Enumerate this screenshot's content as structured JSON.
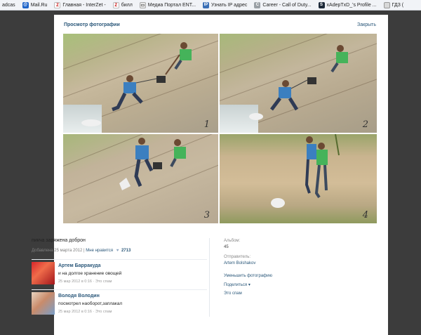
{
  "bookmarks": [
    {
      "label": "adcas",
      "icon": "none"
    },
    {
      "label": "Mail.Ru",
      "icon": "mail-icon"
    },
    {
      "label": "Главная - InterZet -",
      "icon": "interzet-icon"
    },
    {
      "label": "билл",
      "icon": "interzet-icon"
    },
    {
      "label": "Медиа Портал ENT...",
      "icon": "media-icon"
    },
    {
      "label": "Узнать IP адрес",
      "icon": "ip-icon"
    },
    {
      "label": "Career - Call of Duty...",
      "icon": "career-icon"
    },
    {
      "label": "xAdepTxD_'s Profile ...",
      "icon": "steam-icon"
    },
    {
      "label": "ГДЗ (",
      "icon": "gdz-icon"
    }
  ],
  "viewer": {
    "title": "Просмотр фотографии",
    "close": "Закрыть"
  },
  "photo": {
    "frame_numbers": [
      "1",
      "2",
      "3",
      "4"
    ]
  },
  "info": {
    "caption": "пикча заряжена доброн",
    "added": "Добавлена 25 марта 2012",
    "separator": "|",
    "like_label": "Мне нравится",
    "heart": "♥",
    "likes": "2713"
  },
  "comments": [
    {
      "name": "Артем Барракуда",
      "text": "и на долгое хранение овощей",
      "date": "25 мар 2012 в 0:16 · Это спам"
    },
    {
      "name": "Володя Володин",
      "text": "посмотрел наоборот,заплакал",
      "date": "25 мар 2012 в 0:16 · Это спам"
    }
  ],
  "sidebar": {
    "album_label": "Альбом:",
    "album_value": "45",
    "sender_label": "Отправитель:",
    "sender_value": "Artem Bolshakov",
    "shrink": "Уменьшить фотографию",
    "share": "Поделиться",
    "spam": "Это спам"
  },
  "colors": {
    "link": "#2b587a",
    "overlay": "#3c3c3c",
    "panel": "#ffffff"
  }
}
